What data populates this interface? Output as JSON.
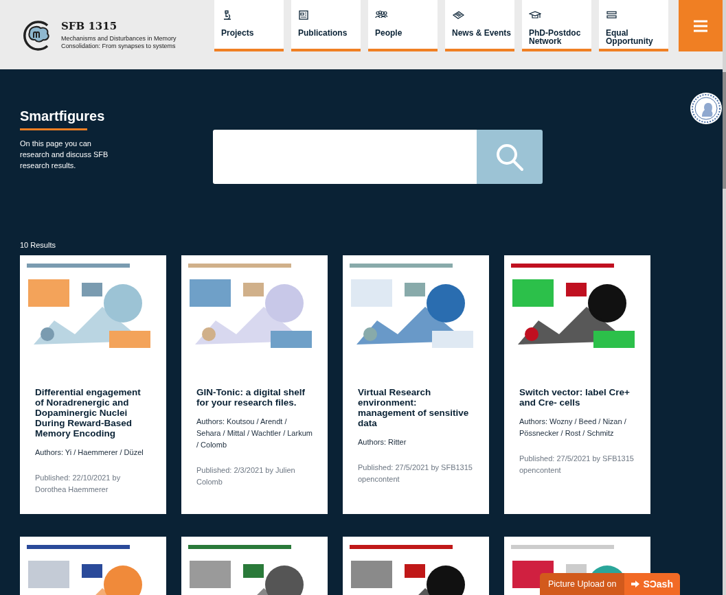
{
  "logo": {
    "title": "SFB 1315",
    "subtitle": "Mechanisms and Disturbances in Memory Consolidation: From synapses to systems"
  },
  "nav": [
    {
      "label": "Projects"
    },
    {
      "label": "Publications"
    },
    {
      "label": "People"
    },
    {
      "label": "News & Events"
    },
    {
      "label": "PhD-Postdoc Network"
    },
    {
      "label": "Equal Opportunity"
    }
  ],
  "page": {
    "title": "Smartfigures",
    "description": "On this page you can research and discuss SFB research results."
  },
  "results_count": "10 Results",
  "cards": [
    {
      "kind": "result",
      "title": "Differential engagement of Noradrenergic and Dopaminergic Nuclei During Reward-Based Memory Encoding",
      "authors": "Authors: Yi / Haemmerer / Düzel",
      "published": "Published: 22/10/2021 by Dorothea Haemmerer"
    },
    {
      "kind": "result",
      "title": "GIN-Tonic: a digital shelf for your research files.",
      "authors": "Authors: Koutsou / Arendt / Sehara / Mittal / Wachtler / Larkum / Colomb",
      "published": "Published: 2/3/2021 by Julien Colomb"
    },
    {
      "kind": "result",
      "title": "Virtual Research environment: management of sensitive data",
      "authors": "Authors: Ritter",
      "published": "Published: 27/5/2021 by SFB1315 opencontent"
    },
    {
      "kind": "result",
      "title": "Switch vector: label Cre+ and Cre- cells",
      "authors": "Authors: Wozny / Beed / Nizan / Pössnecker / Rost / Schmitz",
      "published": "Published: 27/5/2021 by SFB1315 opencontent"
    },
    {
      "kind": "picture"
    },
    {
      "kind": "picture"
    },
    {
      "kind": "picture"
    },
    {
      "kind": "picture"
    }
  ],
  "upload_badge": {
    "label": "Picture Upload on",
    "brand": "SƆash"
  }
}
